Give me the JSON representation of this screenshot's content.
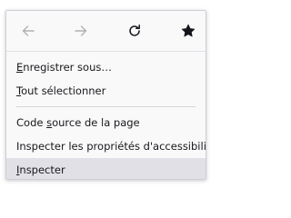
{
  "nav": {
    "back_icon": "arrow-left-icon",
    "forward_icon": "arrow-right-icon",
    "reload_icon": "reload-icon",
    "bookmark_icon": "star-filled-icon",
    "disabled_color": "#b1b1b3",
    "icon_color": "#15141a"
  },
  "menu": {
    "items": [
      {
        "accel": "E",
        "rest": "nregistrer sous…"
      },
      {
        "accel": "T",
        "rest": "out sélectionner"
      },
      {
        "pre": "Code ",
        "accel": "s",
        "rest": "ource de la page"
      },
      {
        "pre": "Inspecter les propriétés d'accessibilité"
      },
      {
        "accel": "I",
        "rest": "nspecter"
      }
    ],
    "highlight_color": "#e0e0e6"
  }
}
